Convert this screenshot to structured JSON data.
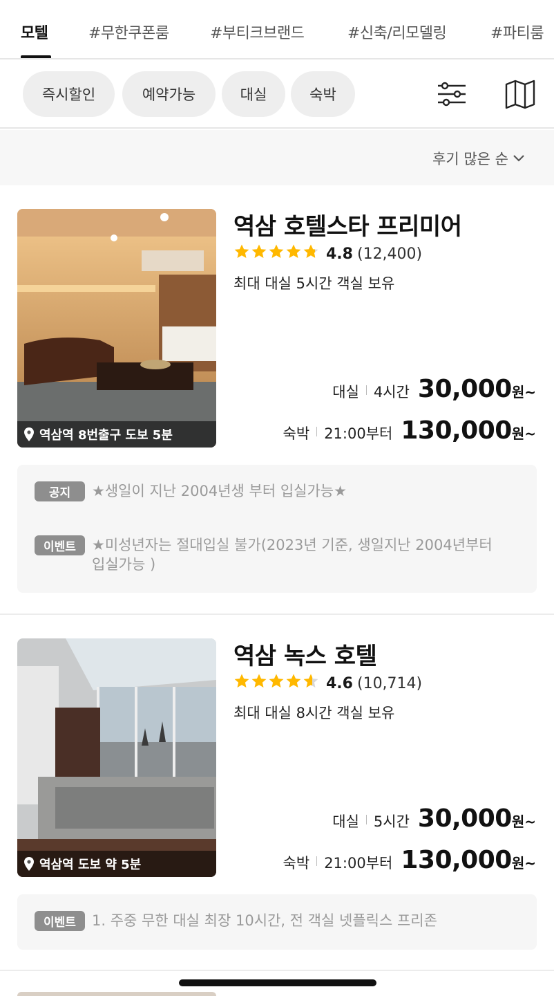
{
  "tabs": [
    {
      "label": "모텔",
      "active": true
    },
    {
      "label": "#무한쿠폰룸",
      "active": false
    },
    {
      "label": "#부티크브랜드",
      "active": false
    },
    {
      "label": "#신축/리모델링",
      "active": false
    },
    {
      "label": "#파티룸",
      "active": false
    }
  ],
  "filters": [
    "즉시할인",
    "예약가능",
    "대실",
    "숙박"
  ],
  "icons": {
    "filter": "sliders-icon",
    "map": "map-icon",
    "sort": "chevron-down-icon",
    "location": "location-pin-icon",
    "star": "star-icon"
  },
  "sort": {
    "label": "후기 많은 순"
  },
  "colors": {
    "star": "#FFB800",
    "tag": "#8E8E8E",
    "chip": "#EEEEEE"
  },
  "listings": [
    {
      "name": "역삼 호텔스타 프리미어",
      "rating": "4.8",
      "rating_value": 4.8,
      "review_count": "(12,400)",
      "description": "최대 대실 5시간 객실 보유",
      "location": "역삼역 8번출구 도보 5분",
      "prices": [
        {
          "type": "대실",
          "detail": "4시간",
          "amount": "30,000",
          "unit": "원~"
        },
        {
          "type": "숙박",
          "detail": "21:00부터",
          "amount": "130,000",
          "unit": "원~"
        }
      ],
      "notices": [
        {
          "tag": "공지",
          "text": "★생일이 지난 2004년생 부터 입실가능★"
        },
        {
          "tag": "이벤트",
          "text": "★미성년자는 절대입실 불가(2023년 기준, 생일지난 2004년부터 입실가능 )"
        }
      ]
    },
    {
      "name": "역삼 녹스 호텔",
      "rating": "4.6",
      "rating_value": 4.6,
      "review_count": "(10,714)",
      "description": "최대 대실 8시간 객실 보유",
      "location": "역삼역 도보 약 5분",
      "prices": [
        {
          "type": "대실",
          "detail": "5시간",
          "amount": "30,000",
          "unit": "원~"
        },
        {
          "type": "숙박",
          "detail": "21:00부터",
          "amount": "130,000",
          "unit": "원~"
        }
      ],
      "notices": [
        {
          "tag": "이벤트",
          "text": "1. 주중 무한 대실 최장 10시간, 전 객실 넷플릭스 프리존"
        }
      ]
    }
  ]
}
